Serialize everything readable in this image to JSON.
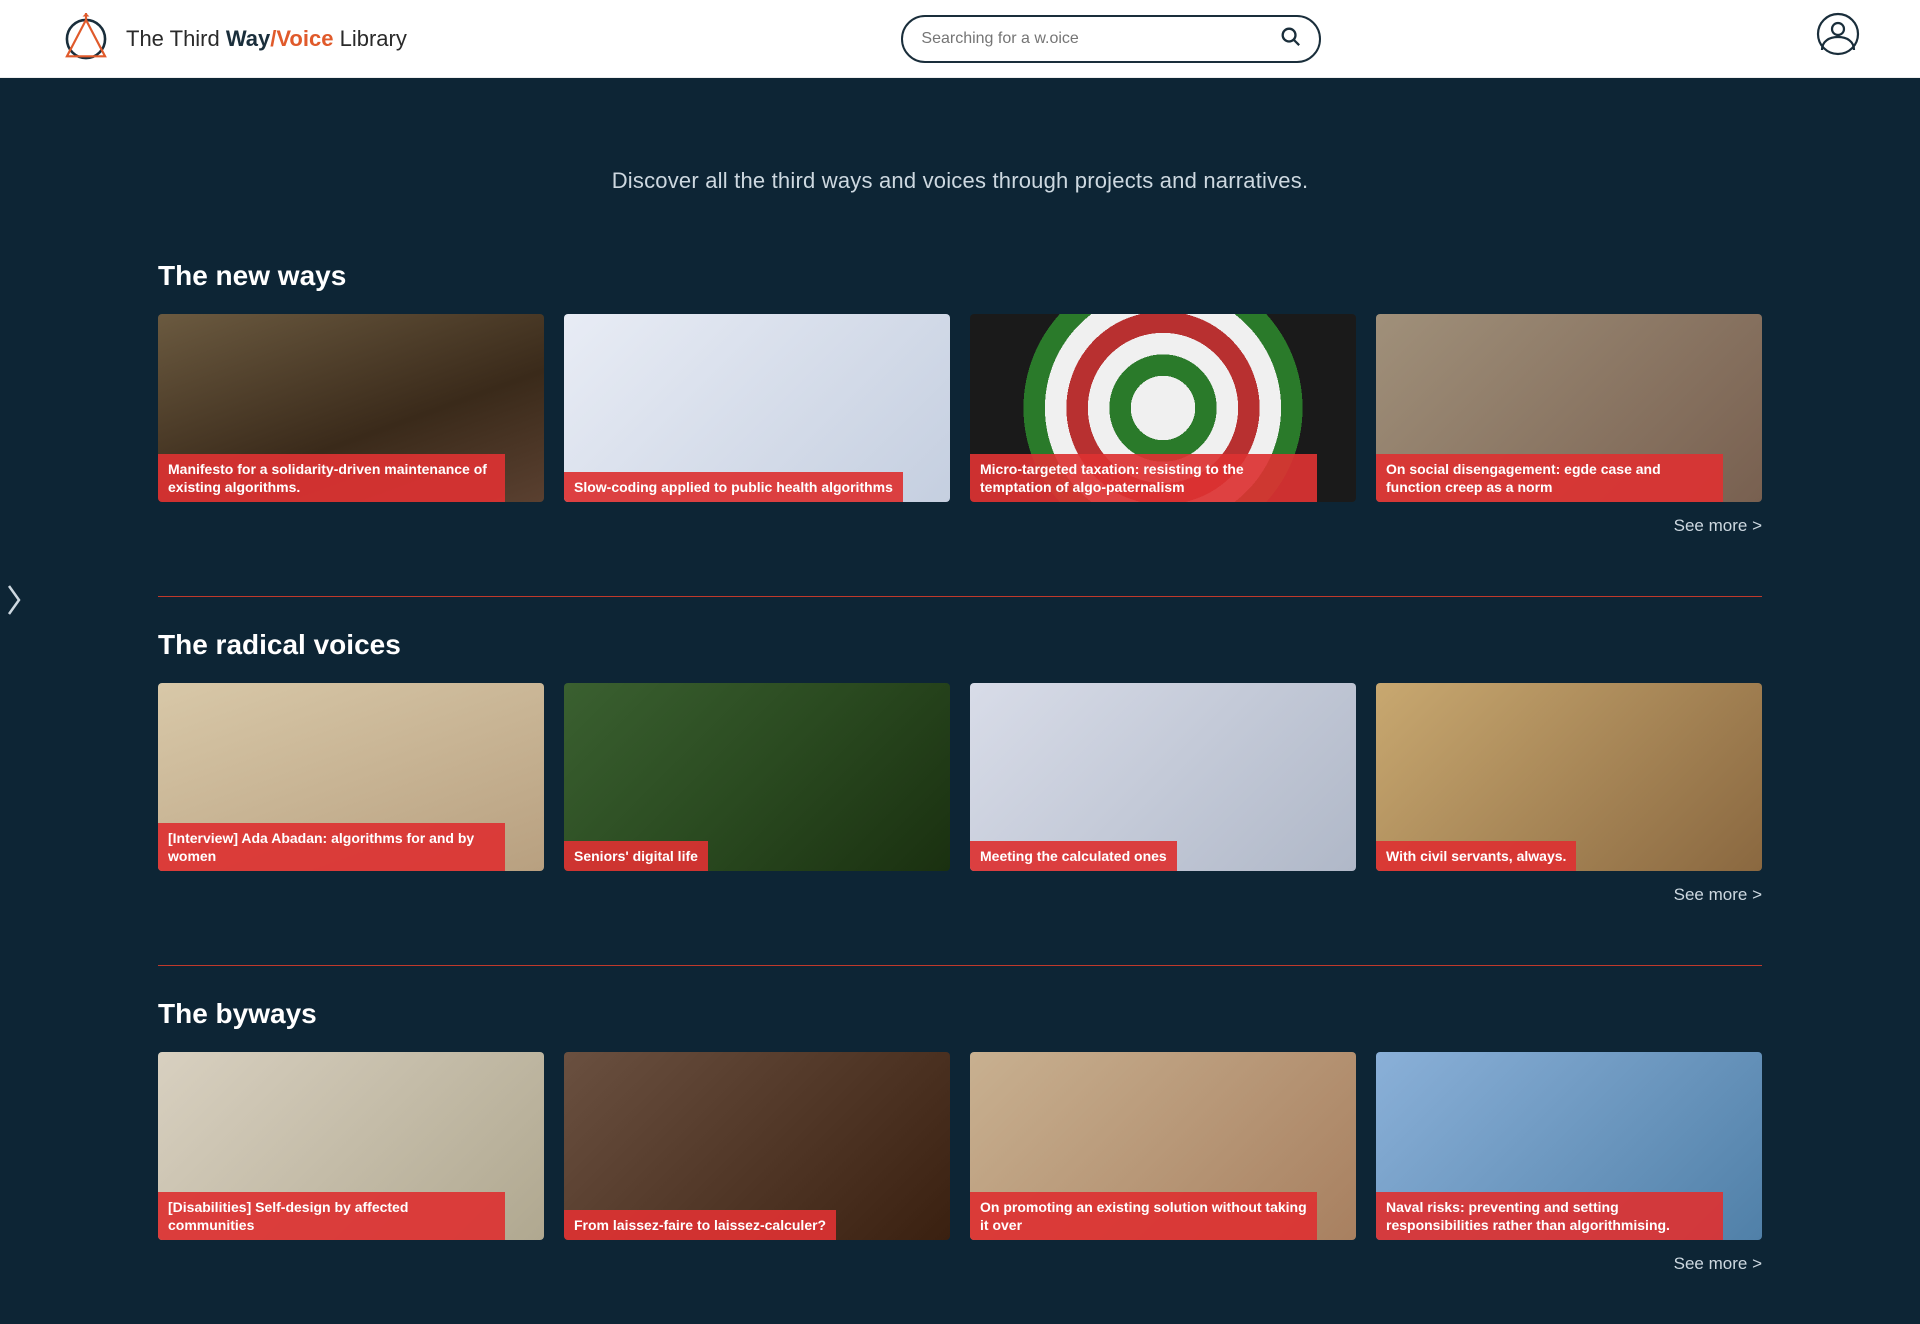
{
  "header": {
    "logo_text_prefix": "The Third ",
    "logo_way": "Way",
    "logo_slash": "/",
    "logo_voice": "Voice",
    "logo_suffix": " Library",
    "search_placeholder": "Searching for a w.oice",
    "user_icon_label": "user account"
  },
  "hero": {
    "tagline": "Discover all the third ways and voices through projects and narratives."
  },
  "sections": [
    {
      "id": "new-ways",
      "title": "The new ways",
      "see_more_label": "See more >",
      "cards": [
        {
          "id": "card-1",
          "label": "Manifesto for a solidarity-driven maintenance of existing algorithms.",
          "bg_class": "card-tools"
        },
        {
          "id": "card-2",
          "label": "Slow-coding applied to public health algorithms",
          "bg_class": "card-medical"
        },
        {
          "id": "card-3",
          "label": "Micro-targeted taxation: resisting to the temptation of algo-paternalism",
          "bg_class": "card-dartboard"
        },
        {
          "id": "card-4",
          "label": "On social disengagement: egde case and function creep as a norm",
          "bg_class": "card-hands"
        }
      ]
    },
    {
      "id": "radical-voices",
      "title": "The radical voices",
      "see_more_label": "See more >",
      "cards": [
        {
          "id": "card-5",
          "label": "[Interview] Ada Abadan: algorithms for and by women",
          "bg_class": "card-hijab"
        },
        {
          "id": "card-6",
          "label": "Seniors' digital life",
          "bg_class": "card-senior"
        },
        {
          "id": "card-7",
          "label": "Meeting the calculated ones",
          "bg_class": "card-group"
        },
        {
          "id": "card-8",
          "label": "With civil servants, always.",
          "bg_class": "card-students"
        }
      ]
    },
    {
      "id": "byways",
      "title": "The byways",
      "see_more_label": "See more >",
      "cards": [
        {
          "id": "card-9",
          "label": "[Disabilities] Self-design by affected communities",
          "bg_class": "card-bike"
        },
        {
          "id": "card-10",
          "label": "From laissez-faire to laissez-calculer?",
          "bg_class": "card-calculator"
        },
        {
          "id": "card-11",
          "label": "On promoting an existing solution without taking it over",
          "bg_class": "card-hand"
        },
        {
          "id": "card-12",
          "label": "Naval risks: preventing and setting responsibilities rather than algorithmising.",
          "bg_class": "card-crane"
        }
      ]
    }
  ]
}
